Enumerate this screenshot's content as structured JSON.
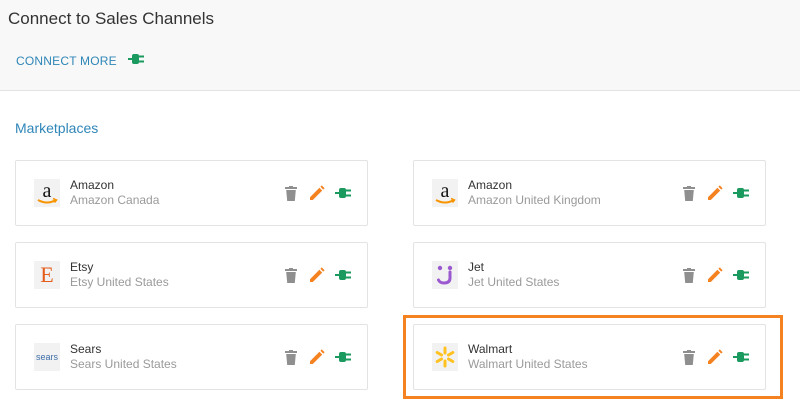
{
  "header": {
    "title": "Connect to Sales Channels",
    "connect_more_label": "CONNECT MORE"
  },
  "section": {
    "title": "Marketplaces"
  },
  "colors": {
    "accent": "#2f86b7",
    "connect_green": "#1a9a5e",
    "edit_orange": "#f58220",
    "delete_gray": "#8f8f8f",
    "highlight_orange": "#f58220"
  },
  "channels": [
    {
      "name": "Amazon",
      "region": "Amazon Canada",
      "logo_icon": "amazon-logo-icon"
    },
    {
      "name": "Amazon",
      "region": "Amazon United Kingdom",
      "logo_icon": "amazon-logo-icon"
    },
    {
      "name": "Etsy",
      "region": "Etsy United States",
      "logo_icon": "etsy-logo-icon"
    },
    {
      "name": "Jet",
      "region": "Jet United States",
      "logo_icon": "jet-logo-icon"
    },
    {
      "name": "Sears",
      "region": "Sears United States",
      "logo_icon": "sears-logo-icon"
    },
    {
      "name": "Walmart",
      "region": "Walmart United States",
      "logo_icon": "walmart-logo-icon",
      "highlighted": true
    }
  ],
  "logos": {
    "etsy_letter": "E",
    "sears_text": "sears"
  }
}
